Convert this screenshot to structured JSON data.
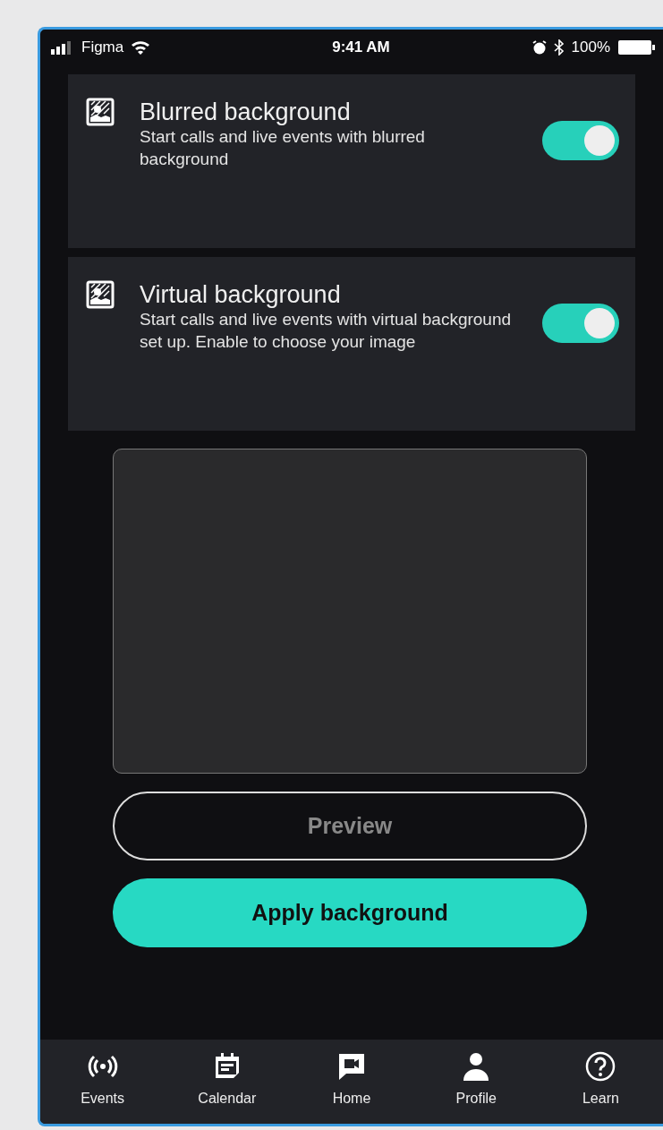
{
  "status_bar": {
    "carrier": "Figma",
    "time": "9:41 AM",
    "battery": "100%"
  },
  "settings": [
    {
      "title": "Blurred background",
      "description": "Start calls and live events with blurred background",
      "on": true
    },
    {
      "title": "Virtual background",
      "description": "Start calls and live events with virtual background set up. Enable to choose your image",
      "on": true
    }
  ],
  "buttons": [
    {
      "label": "Preview",
      "kind": "outline"
    },
    {
      "label": "Apply background",
      "kind": "primary"
    }
  ],
  "nav": [
    {
      "label": "Events",
      "kind": "events"
    },
    {
      "label": "Calendar",
      "kind": "calendar"
    },
    {
      "label": "Home",
      "kind": "home"
    },
    {
      "label": "Profile",
      "kind": "profile"
    },
    {
      "label": "Learn",
      "kind": "learn"
    }
  ]
}
